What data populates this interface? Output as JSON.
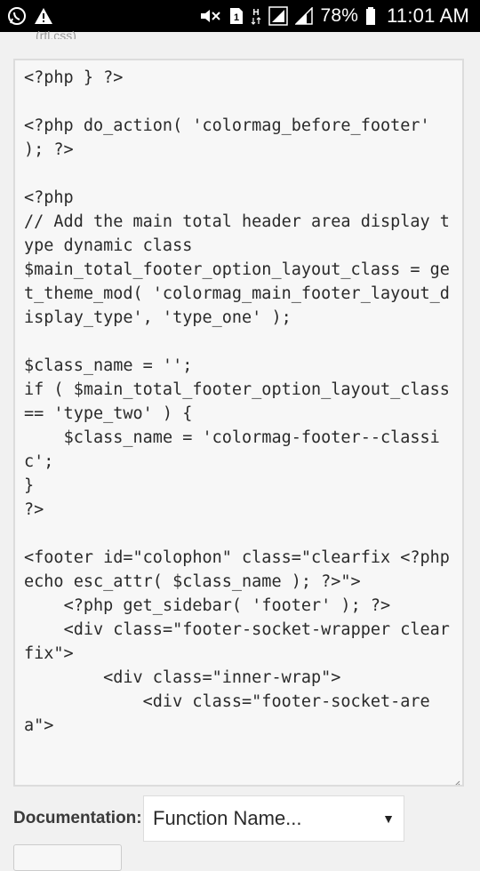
{
  "status_bar": {
    "battery": "78%",
    "time": "11:01 AM",
    "icons": [
      "whatsapp-icon",
      "warning-icon",
      "mute-icon",
      "sim-1-icon",
      "h-data-icon",
      "signal-icon",
      "signal-icon-2",
      "battery-icon"
    ]
  },
  "page": {
    "cutoff_text": "(rtl.css)"
  },
  "editor": {
    "code": "<?php } ?>\n\n<?php do_action( 'colormag_before_footer' ); ?>\n\n<?php\n// Add the main total header area display type dynamic class\n$main_total_footer_option_layout_class = get_theme_mod( 'colormag_main_footer_layout_display_type', 'type_one' );\n\n$class_name = '';\nif ( $main_total_footer_option_layout_class == 'type_two' ) {\n    $class_name = 'colormag-footer--classic';\n}\n?>\n\n<footer id=\"colophon\" class=\"clearfix <?php echo esc_attr( $class_name ); ?>\">\n    <?php get_sidebar( 'footer' ); ?>\n    <div class=\"footer-socket-wrapper clearfix\">\n        <div class=\"inner-wrap\">\n            <div class=\"footer-socket-area\">"
  },
  "documentation": {
    "label": "Documentation:",
    "selected": "Function Name..."
  }
}
